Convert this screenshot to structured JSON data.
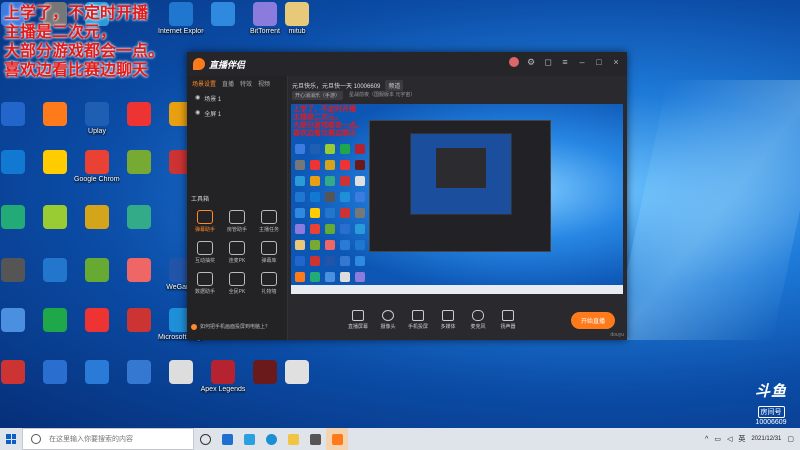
{
  "overlay_lines": [
    "上学了，不定时开播",
    "主播是二次元，",
    "大部分游戏都会一点。",
    "喜欢边看比赛边聊天"
  ],
  "desktop_icons": [
    {
      "label": "",
      "color": "#3c7be0"
    },
    {
      "label": "",
      "color": "#777"
    },
    {
      "label": "",
      "color": "#2a9bd8"
    },
    {
      "label": "Internet Explorer",
      "color": "#1f77d0"
    },
    {
      "label": "",
      "color": "#2f8adf"
    },
    {
      "label": "BitTorrent",
      "color": "#8a7bdc"
    },
    {
      "label": "mitub",
      "color": "#e8c879"
    },
    {
      "label": "",
      "color": "#2266cc"
    },
    {
      "label": "",
      "color": "#ff7a1a"
    },
    {
      "label": "Uplay",
      "color": "#1e5fb3"
    },
    {
      "label": "",
      "color": "#e33"
    },
    {
      "label": "",
      "color": "#e8a010"
    },
    {
      "label": "",
      "color": "#1279d2"
    },
    {
      "label": "",
      "color": "#ffcc00"
    },
    {
      "label": "Google Chrome",
      "color": "#e94235"
    },
    {
      "label": "",
      "color": "#7a3"
    },
    {
      "label": "",
      "color": "#c33"
    },
    {
      "label": "",
      "color": "#2a7"
    },
    {
      "label": "",
      "color": "#9c3"
    },
    {
      "label": "",
      "color": "#d4a51a"
    },
    {
      "label": "",
      "color": "#3a8"
    },
    {
      "label": "",
      "color": "#555"
    },
    {
      "label": "",
      "color": "#27c"
    },
    {
      "label": "",
      "color": "#6a3"
    },
    {
      "label": "",
      "color": "#e66"
    },
    {
      "label": "WeGame",
      "color": "#2255aa"
    },
    {
      "label": "",
      "color": "#4a8fe0"
    },
    {
      "label": "",
      "color": "#1fa84a"
    },
    {
      "label": "",
      "color": "#e33"
    },
    {
      "label": "",
      "color": "#c33"
    },
    {
      "label": "Microsoft Edge",
      "color": "#1f8fd8"
    },
    {
      "label": "",
      "color": "#c33"
    },
    {
      "label": "",
      "color": "#2a6ed0"
    },
    {
      "label": "",
      "color": "#2a7bd8"
    },
    {
      "label": "",
      "color": "#3478d2"
    },
    {
      "label": "",
      "color": "#ddd"
    },
    {
      "label": "Apex Legends",
      "color": "#b4232f"
    },
    {
      "label": "",
      "color": "#6a1a1a"
    },
    {
      "label": "",
      "color": "#e0e0e0"
    }
  ],
  "app": {
    "logo_text": "直播伴侣",
    "sidebar_tabs": [
      "场景设置",
      "直播",
      "特效",
      "视频"
    ],
    "scene_rows": [
      "场景 1",
      "全屏 1"
    ],
    "tools_heading": "工具箱",
    "tools": [
      "弹幕助手",
      "房管助手",
      "主播任务",
      "互动抽奖",
      "连麦PK",
      "弹幕库",
      "数据助手",
      "全民PK",
      "礼物墙"
    ],
    "notice": "如何把手机画面投屏到电脑上？",
    "room_title": "元旦快乐，元旦快一天 10006609",
    "room_category": "频道",
    "sub_items": [
      "开心消消乐（手游）",
      "星战前夜（国服版本 元宇宙）"
    ],
    "controls": [
      "直播屏幕",
      "摄像头",
      "手机投屏",
      "多媒体",
      "麦克风",
      "扬声器"
    ],
    "start_button": "开始直播",
    "brand_tiny": "douyu"
  },
  "watermark": {
    "logo": "斗鱼",
    "room_label": "房间号",
    "room_number": "10006609"
  },
  "taskbar": {
    "search_placeholder": "在这里输入你要搜索的内容",
    "tray_lang": "英",
    "time": "",
    "date": "2021/12/31"
  }
}
